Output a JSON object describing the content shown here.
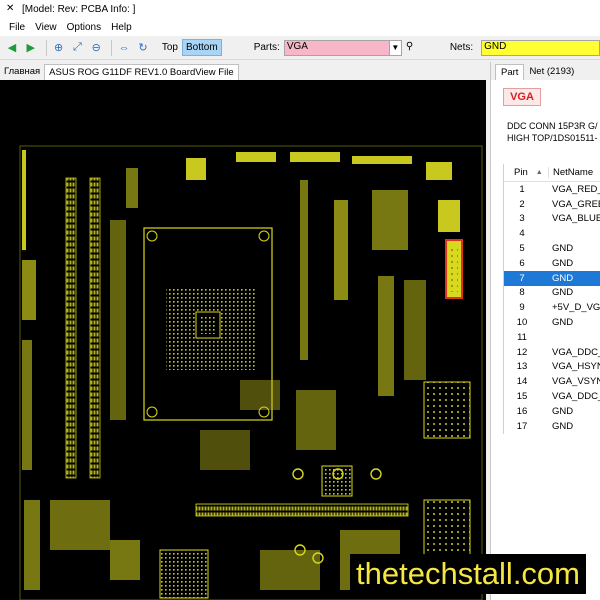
{
  "window": {
    "title": "[Model: Rev: PCBA Info: ]"
  },
  "menu": {
    "items": [
      "File",
      "View",
      "Options",
      "Help"
    ]
  },
  "toolbar": {
    "top_label": "Top",
    "bottom_label": "Bottom",
    "parts_label": "Parts:",
    "parts_value": "VGA",
    "nets_label": "Nets:",
    "nets_value": "GND"
  },
  "left_tabs": [
    "Главная",
    "ASUS ROG G11DF REV1.0 BoardView File"
  ],
  "right_panel": {
    "tabs": [
      "Part",
      "Net (2193)"
    ],
    "part_name": "VGA",
    "desc_line1": "DDC CONN 15P3R G/",
    "desc_line2": "HIGH TOP/1DS01511-",
    "columns": [
      "Pin",
      "NetName"
    ],
    "rows": [
      {
        "pin": "1",
        "net": "VGA_RED_"
      },
      {
        "pin": "2",
        "net": "VGA_GREE"
      },
      {
        "pin": "3",
        "net": "VGA_BLUE"
      },
      {
        "pin": "4",
        "net": ""
      },
      {
        "pin": "5",
        "net": "GND"
      },
      {
        "pin": "6",
        "net": "GND"
      },
      {
        "pin": "7",
        "net": "GND"
      },
      {
        "pin": "8",
        "net": "GND"
      },
      {
        "pin": "9",
        "net": "+5V_D_VG"
      },
      {
        "pin": "10",
        "net": "GND"
      },
      {
        "pin": "11",
        "net": ""
      },
      {
        "pin": "12",
        "net": "VGA_DDC_"
      },
      {
        "pin": "13",
        "net": "VGA_HSYN"
      },
      {
        "pin": "14",
        "net": "VGA_VSYN"
      },
      {
        "pin": "15",
        "net": "VGA_DDC_"
      },
      {
        "pin": "16",
        "net": "GND"
      },
      {
        "pin": "17",
        "net": "GND"
      }
    ],
    "selected_pin": "7"
  },
  "watermark": "thetechstall.com",
  "colors": {
    "board_bg": "#000000",
    "trace": "#d8d81e",
    "highlight": "#e03020",
    "selected_row": "#1e78d6"
  }
}
